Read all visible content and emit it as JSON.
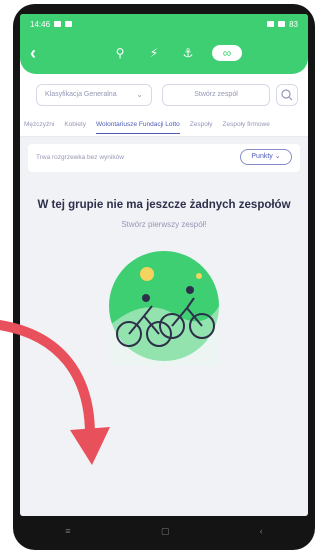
{
  "status_bar": {
    "time": "14:46",
    "battery": "83"
  },
  "header": {
    "modes": [
      "bike-icon",
      "run-icon",
      "walk-icon",
      "link-icon"
    ],
    "active_mode": "link-icon"
  },
  "filters": {
    "classification_label": "Klasyfikacja Generalna",
    "search_placeholder": "Stwórz zespół"
  },
  "tabs": [
    "Mężczyźni",
    "Kobiety",
    "Wolontariusze Fundacji Lotto",
    "Zespoły",
    "Zespoły firmowe"
  ],
  "active_tab": "Wolontariusze Fundacji Lotto",
  "status": {
    "text": "Trwa rozgrzewka bez wyników",
    "sort_label": "Punkty"
  },
  "empty_state": {
    "title": "W tej grupie nie ma jeszcze żadnych zespołów",
    "subtitle": "Stwórz pierwszy zespół!"
  },
  "colors": {
    "brand": "#3fcf73",
    "accent": "#4f5bb5",
    "arrow": "#e8505b"
  }
}
